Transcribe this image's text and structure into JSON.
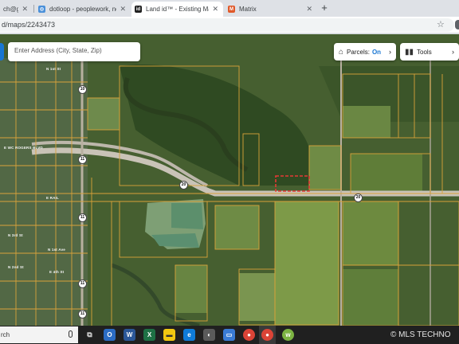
{
  "browser": {
    "tabs": [
      {
        "title": "ch@gre",
        "active": false
      },
      {
        "title": "dotloop - peoplework, not pap",
        "active": false
      },
      {
        "title": "Land id™ - Existing Map Edit",
        "active": true
      },
      {
        "title": "Matrix",
        "active": false
      }
    ],
    "new_tab": "+",
    "url": "d/maps/2243473"
  },
  "map": {
    "search_placeholder": "Enter Address (City, State, Zip)",
    "parcels_label": "Parcels:",
    "parcels_state": "On",
    "tools_label": "Tools",
    "road_labels": [
      "N 1st St",
      "E WC ROGERS BLVD",
      "E RAIL",
      "N 3rd St",
      "N 1st Ave",
      "N 2nd St",
      "E 4th St"
    ],
    "shields": [
      "10",
      "11",
      "20",
      "20",
      "11",
      "11",
      "11"
    ]
  },
  "taskbar": {
    "search_text": "rch"
  },
  "watermark": "© MLS TECHNO",
  "colors": {
    "parcel_line": "#d9a23a",
    "selected_parcel": "#e53935",
    "accent": "#1976d2"
  }
}
